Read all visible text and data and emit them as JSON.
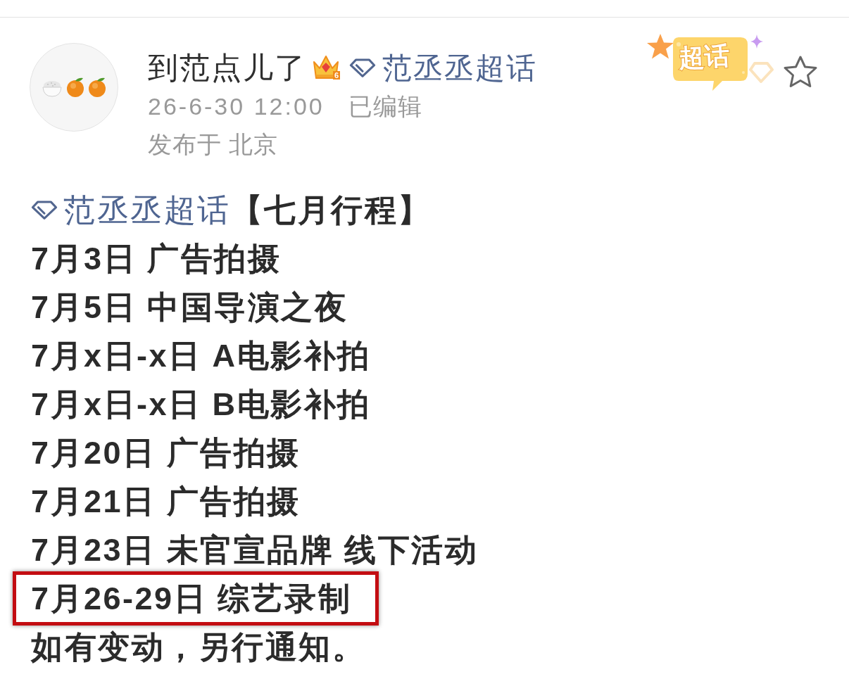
{
  "header": {
    "username": "到范点儿了",
    "member_level": "6",
    "topic": "范丞丞超话",
    "timestamp": "26-6-30 12:00",
    "edit_status": "已编辑",
    "location": "发布于 北京",
    "sticker_label": "超话",
    "favorited": false
  },
  "post": {
    "topic": "范丞丞超话",
    "title": "【七月行程】",
    "lines": [
      {
        "text": "7月3日 广告拍摄",
        "highlighted": false
      },
      {
        "text": "7月5日 中国导演之夜",
        "highlighted": false
      },
      {
        "text": "7月x日-x日 A电影补拍",
        "highlighted": false
      },
      {
        "text": "7月x日-x日 B电影补拍",
        "highlighted": false
      },
      {
        "text": "7月20日 广告拍摄",
        "highlighted": false
      },
      {
        "text": "7月21日 广告拍摄",
        "highlighted": false
      },
      {
        "text": "7月23日 未官宣品牌 线下活动",
        "highlighted": false
      },
      {
        "text": "7月26-29日 综艺录制",
        "highlighted": true
      },
      {
        "text": "如有变动，另行通知。",
        "highlighted": false
      }
    ]
  }
}
